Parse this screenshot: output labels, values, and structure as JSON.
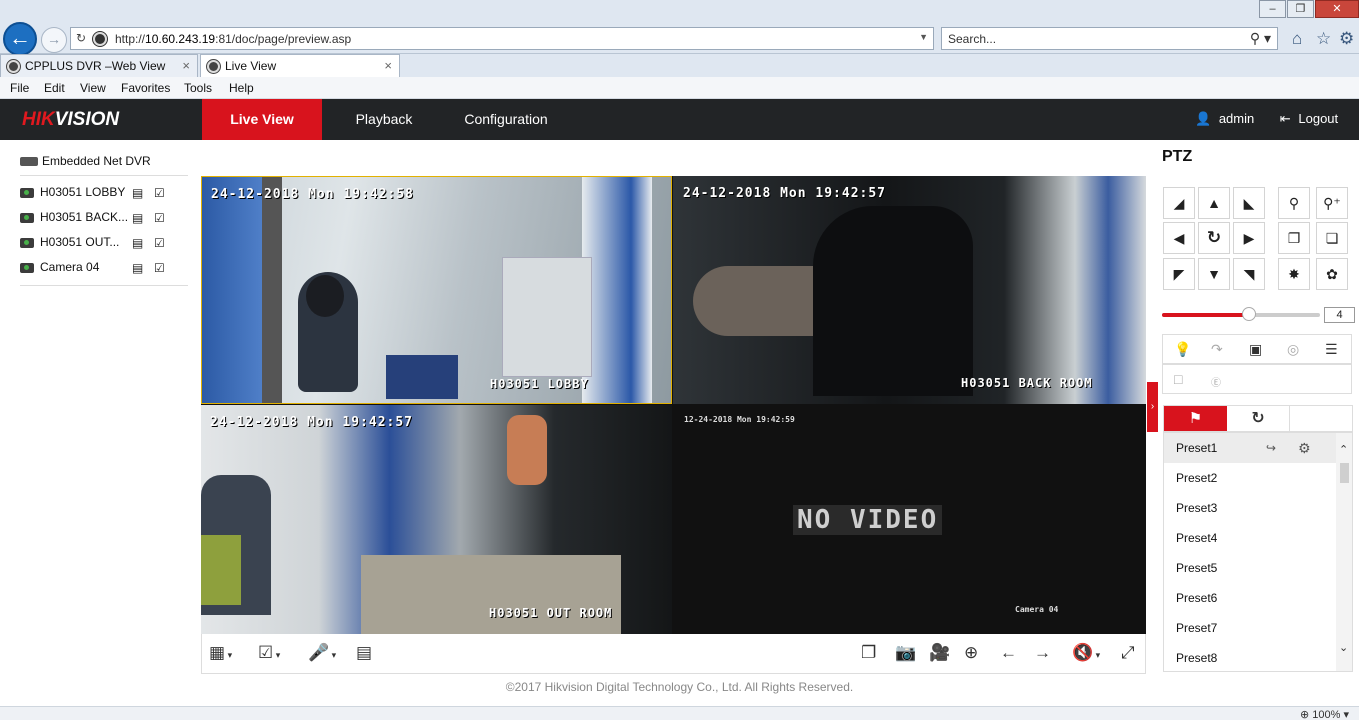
{
  "browser": {
    "url_prefix": "http://",
    "url_host": "10.60.243.19",
    "url_rest": ":81/doc/page/preview.asp",
    "search_placeholder": "Search...",
    "tabs": [
      {
        "label": "CPPLUS DVR –Web View"
      },
      {
        "label": "Live View"
      }
    ],
    "menu": [
      "File",
      "Edit",
      "View",
      "Favorites",
      "Tools",
      "Help"
    ],
    "zoom": "100%"
  },
  "app": {
    "logo_hi": "HIK",
    "logo_rest": "VISION",
    "nav": [
      "Live View",
      "Playback",
      "Configuration"
    ],
    "user": "admin",
    "logout": "Logout"
  },
  "tree": {
    "root": "Embedded Net DVR",
    "cameras": [
      "H03051 LOBBY",
      "H03051 BACK...",
      "H03051 OUT...",
      "Camera 04"
    ]
  },
  "video": {
    "tiles": [
      {
        "timestamp": "24-12-2018 Mon 19:42:58",
        "label": "H03051 LOBBY"
      },
      {
        "timestamp": "24-12-2018 Mon 19:42:57",
        "label": "H03051 BACK ROOM"
      },
      {
        "timestamp": "24-12-2018 Mon 19:42:57",
        "label": "H03051 OUT ROOM"
      },
      {
        "timestamp": "12-24-2018 Mon 19:42:59",
        "label": "Camera 04",
        "center": "NO VIDEO"
      }
    ]
  },
  "ptz": {
    "title": "PTZ",
    "speed": "4",
    "speed_fraction": 0.55,
    "presets": [
      "Preset1",
      "Preset2",
      "Preset3",
      "Preset4",
      "Preset5",
      "Preset6",
      "Preset7",
      "Preset8"
    ]
  },
  "footer": "©2017 Hikvision Digital Technology Co., Ltd. All Rights Reserved.",
  "colors": {
    "accent": "#d8131d",
    "header": "#222426"
  }
}
